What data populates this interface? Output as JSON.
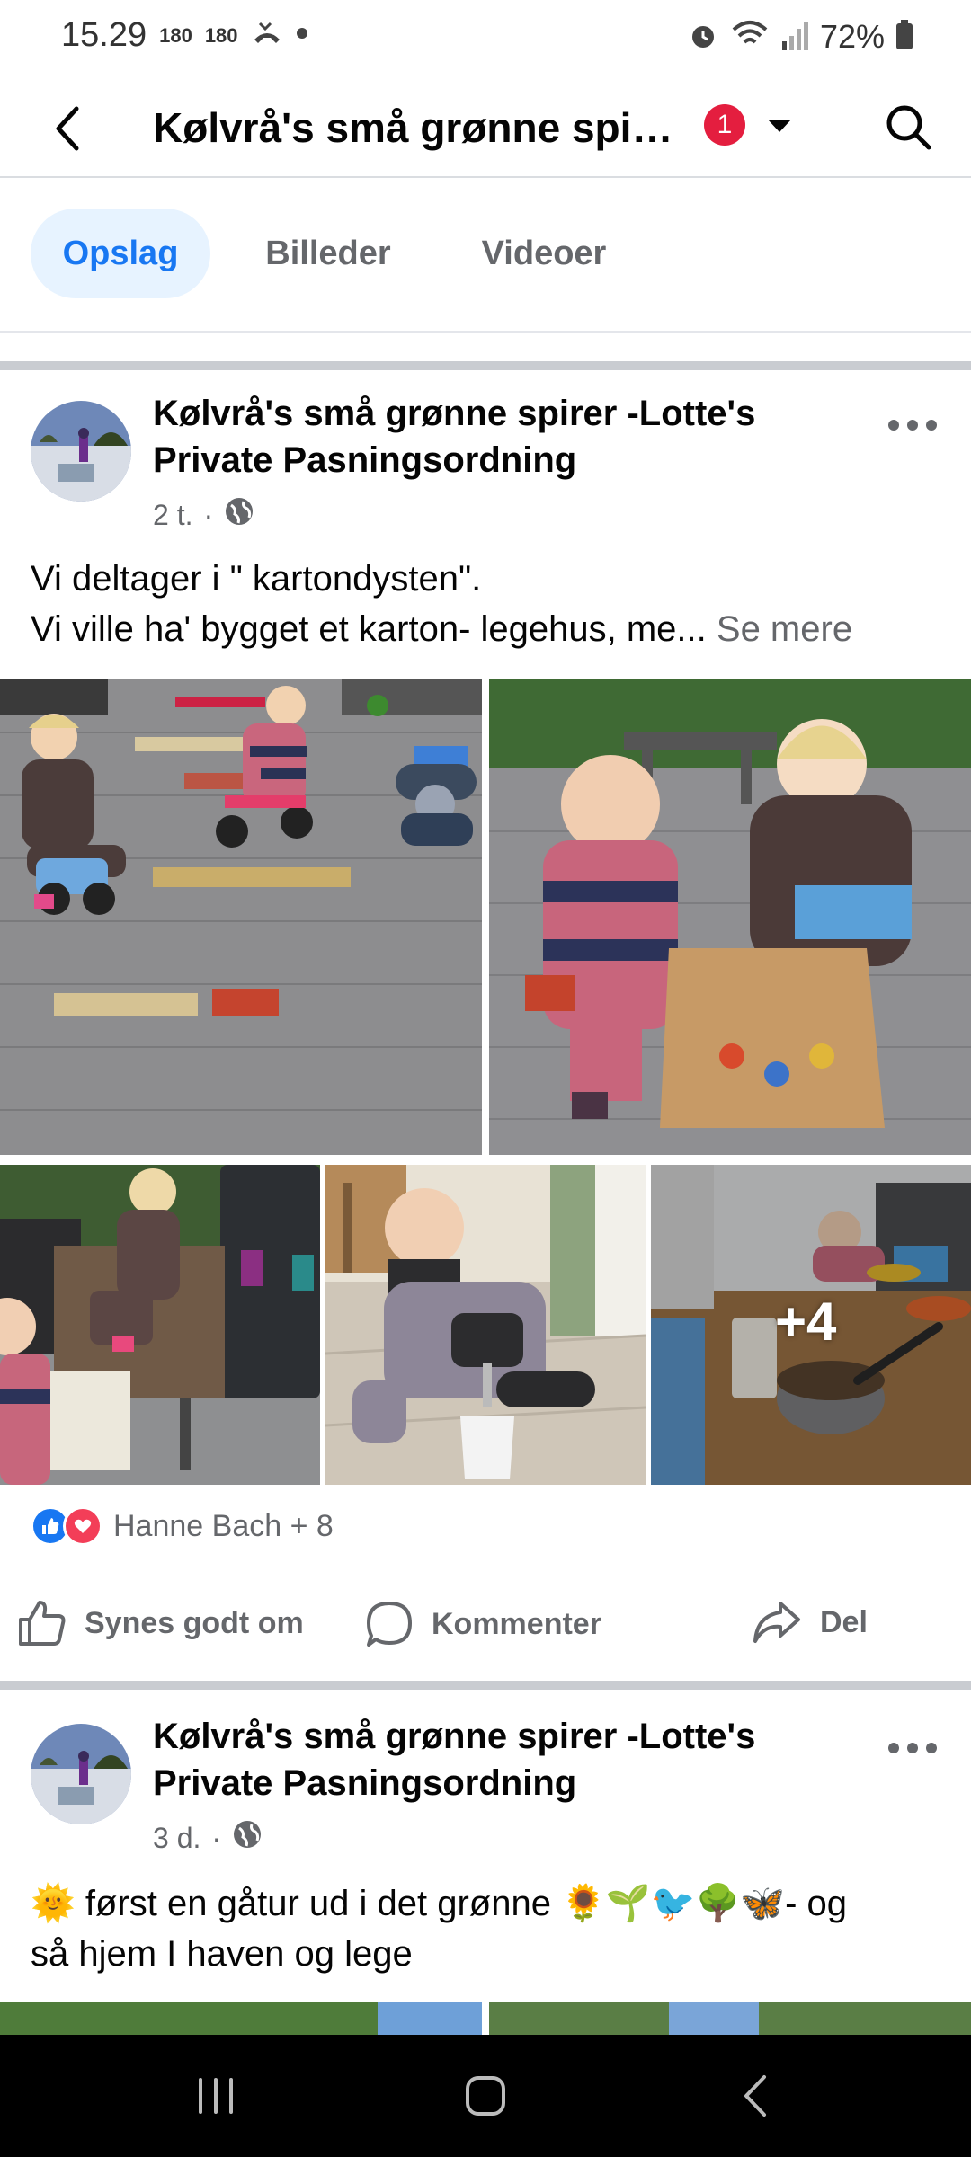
{
  "status_bar": {
    "time": "15.29",
    "indicator1": "180",
    "indicator2": "180",
    "battery": "72%"
  },
  "header": {
    "title": "Kølvrå's små grønne spirer...",
    "notification_count": "1"
  },
  "tabs": [
    {
      "label": "Opslag",
      "active": true
    },
    {
      "label": "Billeder",
      "active": false
    },
    {
      "label": "Videoer",
      "active": false
    }
  ],
  "posts": [
    {
      "author": "Kølvrå's små grønne spirer -Lotte's Private Pasningsordning",
      "time": "2 t.",
      "text_line1": "Vi deltager i \" kartondysten\".",
      "text_line2": "Vi ville ha' bygget et karton- legehus, me...",
      "see_more": "Se mere",
      "more_photos": "+4",
      "reactions_text": "Hanne Bach + 8"
    },
    {
      "author": "Kølvrå's små grønne spirer -Lotte's Private Pasningsordning",
      "time": "3 d.",
      "text_line1": "🌞 først en gåtur ud i det grønne 🌻🌱🐦🌳🦋- og",
      "text_line2": "så hjem I haven og lege"
    }
  ],
  "actions": {
    "like": "Synes godt om",
    "comment": "Kommenter",
    "share": "Del"
  },
  "colors": {
    "accent": "#1877f2",
    "tab_active_bg": "#e7f3ff",
    "badge": "#e41e3f",
    "like_blue": "#1877f2",
    "love_red": "#f33e58"
  }
}
